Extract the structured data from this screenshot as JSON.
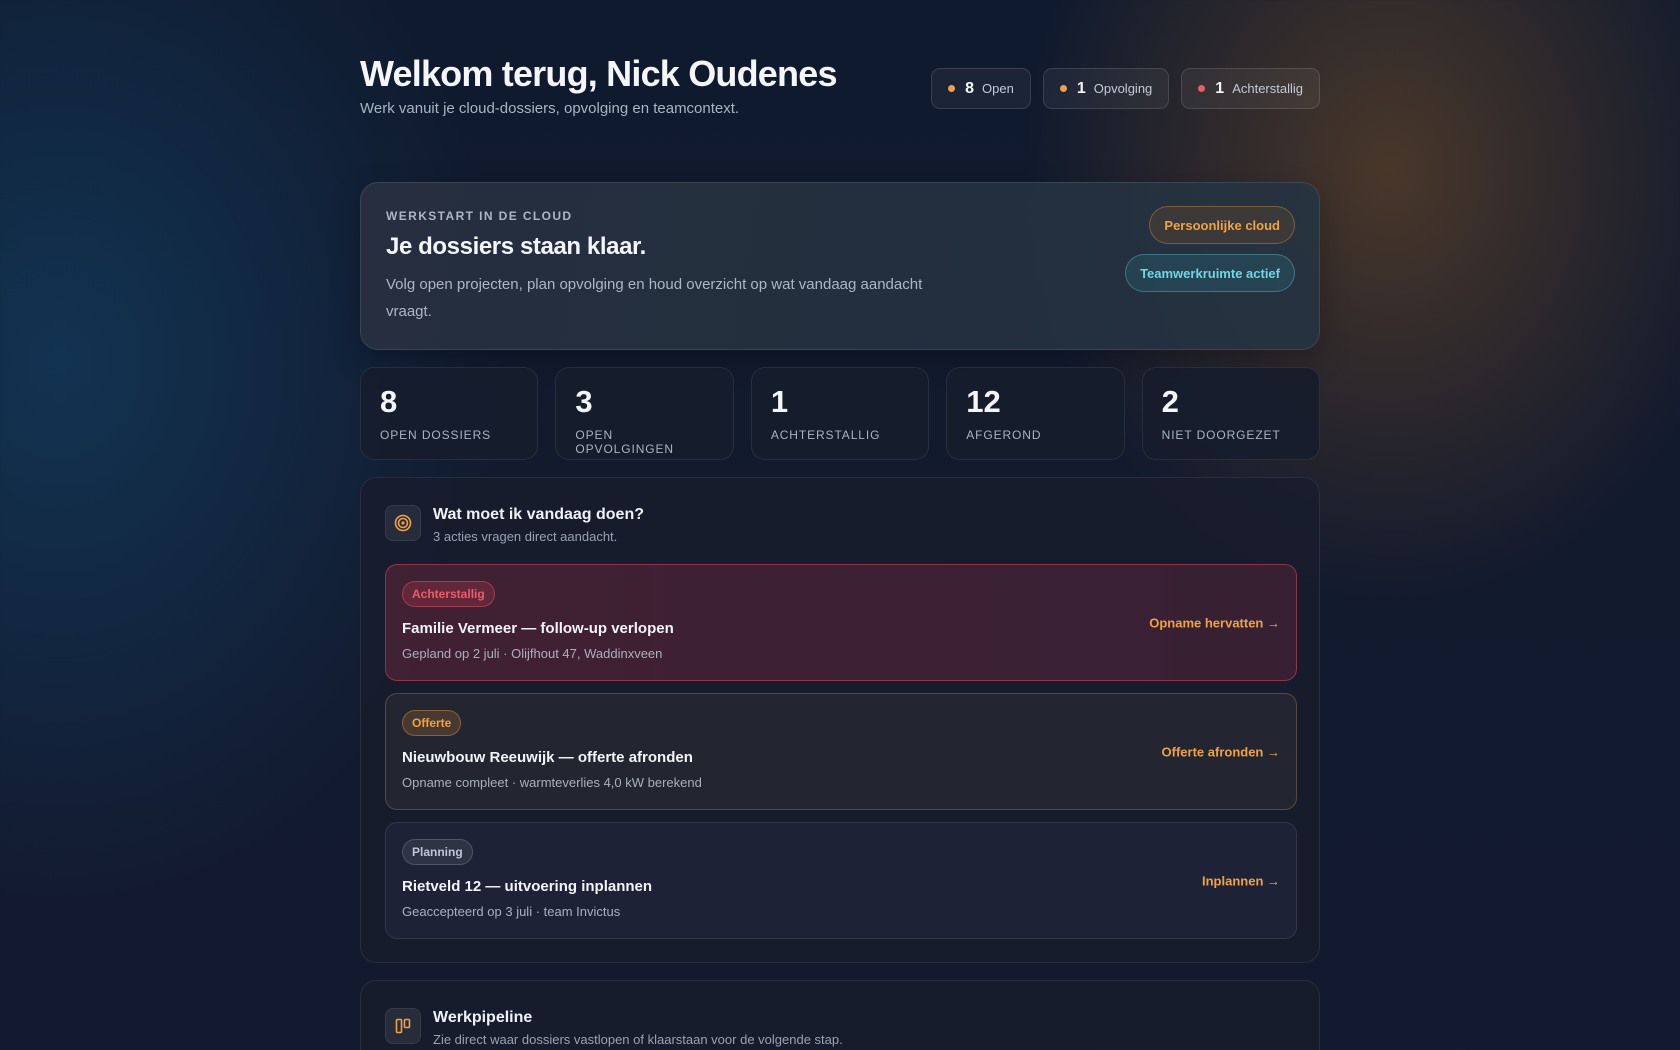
{
  "header": {
    "title": "Welkom terug, Nick Oudenes",
    "subtitle": "Werk vanuit je cloud-dossiers, opvolging en teamcontext.",
    "pills": [
      {
        "count": "8",
        "label": "Open",
        "dot_color": "#f0a240"
      },
      {
        "count": "1",
        "label": "Opvolging",
        "dot_color": "#f0a240"
      },
      {
        "count": "1",
        "label": "Achterstallig",
        "dot_color": "#ee5c68"
      }
    ]
  },
  "hero": {
    "eyebrow": "WERKSTART IN DE CLOUD",
    "title": "Je dossiers staan klaar.",
    "text": "Volg open projecten, plan opvolging en houd overzicht op wat vandaag aandacht vraagt.",
    "badge_cloud": "Persoonlijke cloud",
    "badge_team": "Teamwerkruimte actief"
  },
  "stats": [
    {
      "value": "8",
      "label": "Open dossiers"
    },
    {
      "value": "3",
      "label": "Open opvolgingen"
    },
    {
      "value": "1",
      "label": "Achterstallig"
    },
    {
      "value": "12",
      "label": "Afgerond"
    },
    {
      "value": "2",
      "label": "Niet doorgezet"
    }
  ],
  "today": {
    "icon": "target-icon",
    "title": "Wat moet ik vandaag doen?",
    "subtitle": "3 acties vragen direct aandacht.",
    "tasks": [
      {
        "tag": "Achterstallig",
        "title": "Familie Vermeer — follow-up verlopen",
        "meta": "Gepland op 2 juli · Olijfhout 47, Waddinxveen",
        "action": "Opname hervatten →"
      },
      {
        "tag": "Offerte",
        "title": "Nieuwbouw Reeuwijk — offerte afronden",
        "meta": "Opname compleet · warmteverlies 4,0 kW berekend",
        "action": "Offerte afronden →"
      },
      {
        "tag": "Planning",
        "title": "Rietveld 12 — uitvoering inplannen",
        "meta": "Geaccepteerd op 3 juli · team Invictus",
        "action": "Inplannen →"
      }
    ]
  },
  "pipeline": {
    "icon": "kanban-icon",
    "title": "Werkpipeline",
    "subtitle": "Zie direct waar dossiers vastlopen of klaarstaan voor de volgende stap."
  },
  "colors": {
    "accent_orange": "#f0a240",
    "alert_red": "#ee5c68",
    "accent_cyan": "#6fd6e4"
  }
}
